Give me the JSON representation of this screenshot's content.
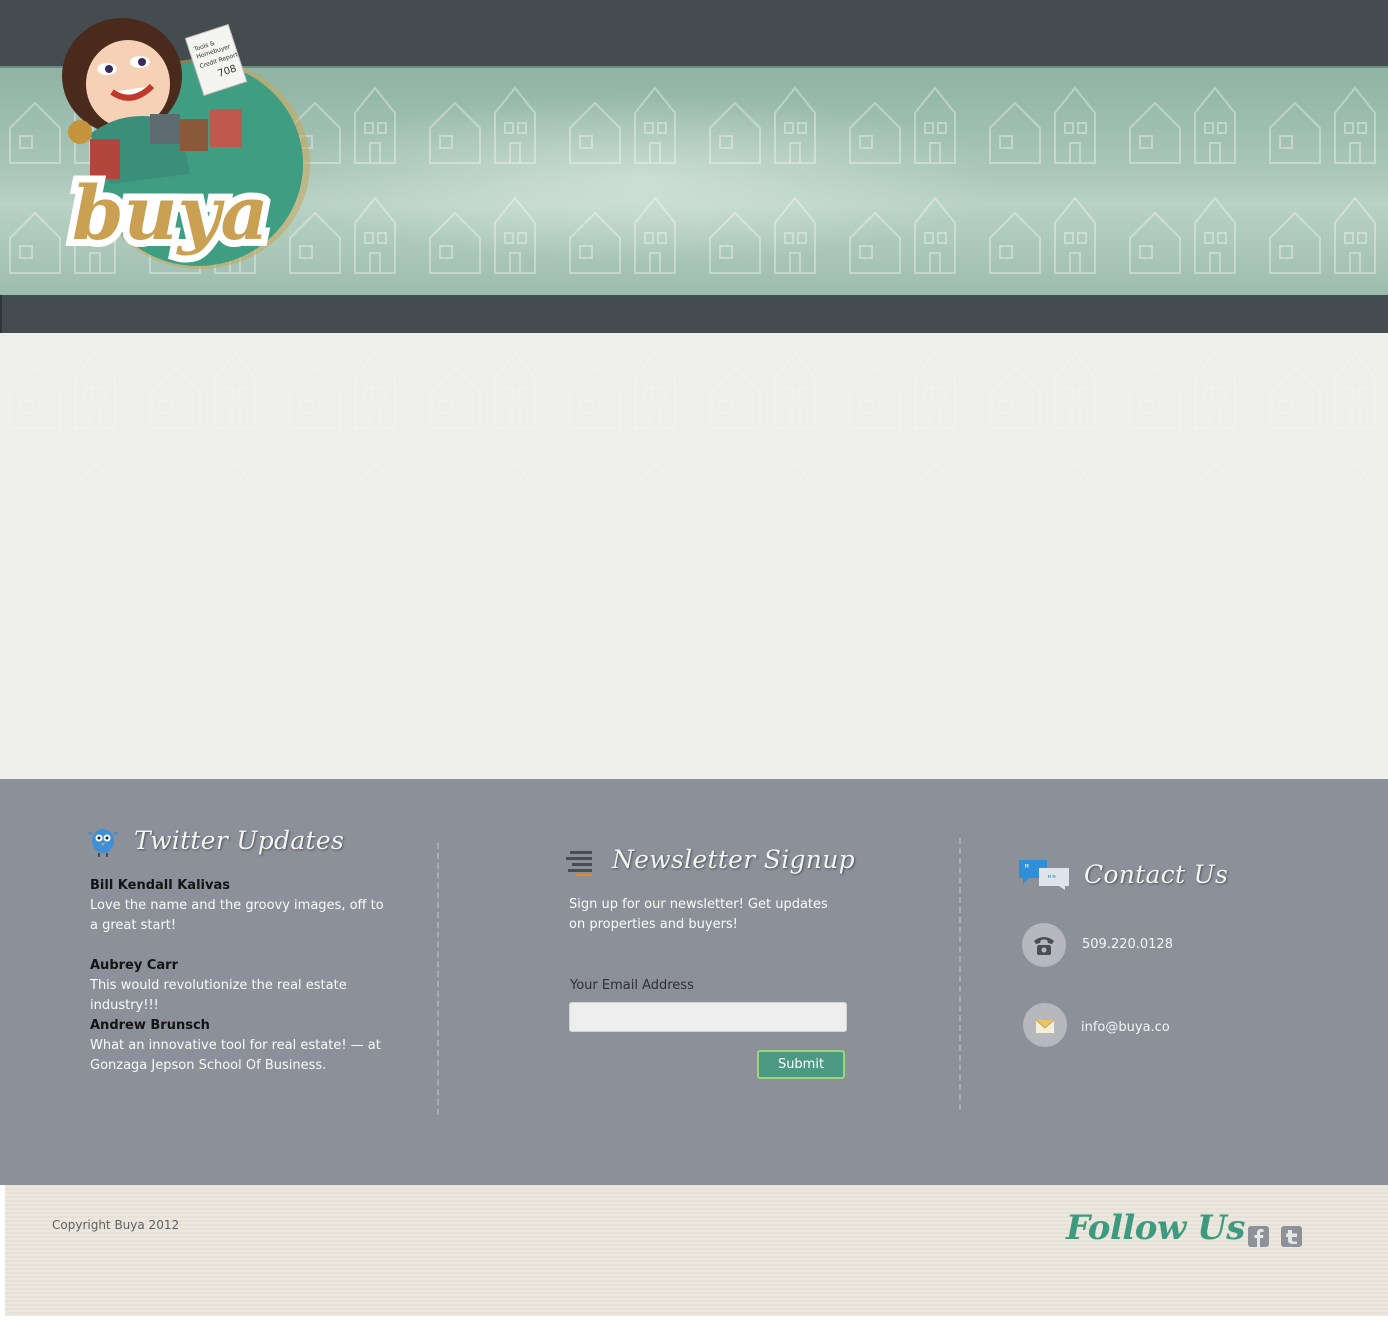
{
  "header": {
    "logo_text": "buya",
    "logo_card_text": [
      "Tools &",
      "Homebuyer",
      "Credit Report",
      "708"
    ]
  },
  "footer": {
    "twitter": {
      "title": "Twitter Updates",
      "tweets": [
        {
          "author": "Bill Kendall Kalivas",
          "text": "Love the name and the groovy images, off to a great start!"
        },
        {
          "author": "Aubrey Carr",
          "text": "This would revolutionize the real estate industry!!!"
        },
        {
          "author": "Andrew Brunsch",
          "text": "What an innovative tool for real estate! — at Gonzaga Jepson School Of Business."
        }
      ]
    },
    "newsletter": {
      "title": "Newsletter Signup",
      "description": "Sign up for our newsletter! Get updates on properties and buyers!",
      "email_label": "Your Email Address",
      "email_value": "",
      "email_placeholder": "",
      "submit_label": "Submit"
    },
    "contact": {
      "title": "Contact Us",
      "phone": "509.220.0128",
      "email": "info@buya.co"
    }
  },
  "bottom": {
    "copyright": "Copyright Buya 2012",
    "follow_label": "Follow Us",
    "social": [
      "facebook",
      "twitter"
    ]
  },
  "colors": {
    "topbar": "#454c50",
    "banner": "#a9c6b9",
    "footer": "#8c9098",
    "accent": "#4c9a82",
    "follow": "#3e9a7e"
  }
}
